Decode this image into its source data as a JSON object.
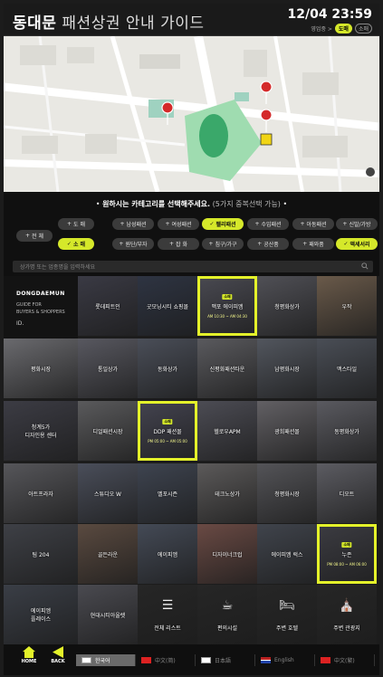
{
  "header": {
    "place": "동대문",
    "title_rest": "패션상권 안내 가이드",
    "clock": "12/04 23:59",
    "view_label": "영업중 >",
    "view_on": "도매",
    "view_off": "소매"
  },
  "category": {
    "prompt_main": "원하시는 카테고리를 선택해주세요.",
    "prompt_hint": "(5가지 중복선택 가능)",
    "chips": [
      {
        "label": "전 체",
        "selected": false
      },
      {
        "label": "도 매",
        "selected": false
      },
      {
        "label": "남성패션",
        "selected": false
      },
      {
        "label": "여성패션",
        "selected": false
      },
      {
        "label": "펠리패션",
        "selected": true
      },
      {
        "label": "수입패션",
        "selected": false
      },
      {
        "label": "아동패션",
        "selected": false
      },
      {
        "label": "신발/가방",
        "selected": false
      },
      {
        "label": "소 매",
        "selected": true
      },
      {
        "label": "원단/부자",
        "selected": false
      },
      {
        "label": "잡 화",
        "selected": false
      },
      {
        "label": "침구/가구",
        "selected": false
      },
      {
        "label": "공산품",
        "selected": false
      },
      {
        "label": "패와품",
        "selected": false
      },
      {
        "label": "액세서리",
        "selected": true
      }
    ],
    "search_placeholder": "상가명 또는 업종명을 입력하세요"
  },
  "sidebar": {
    "brand": "DONGDAEMUN",
    "guide": "GUIDE FOR\nBUYERS & SHOPPERS",
    "logo": "ID."
  },
  "tiles": [
    {
      "label": "롯데피트인",
      "bg": "#3a3a44"
    },
    {
      "label": "굿모닝시티 쇼핑몰",
      "bg": "#2e3442"
    },
    {
      "label": "맥포 에이피엠",
      "bg": "#4a4a52",
      "highlight": true,
      "tag": "소매",
      "hours": "AM 10:30 ~ AM 04:30"
    },
    {
      "label": "청평화상가",
      "bg": "#505056"
    },
    {
      "label": "우작",
      "bg": "#6a5a4a"
    },
    {
      "label": "평화시장",
      "bg": "#6a6a6e"
    },
    {
      "label": "통일상가",
      "bg": "#585860"
    },
    {
      "label": "동화상가",
      "bg": "#4a4e58"
    },
    {
      "label": "신평화패션타운",
      "bg": "#5a5a5e"
    },
    {
      "label": "남평화시장",
      "bg": "#52565e"
    },
    {
      "label": "맥스타일",
      "bg": "#4a4e56"
    },
    {
      "label": "청계5가\n디자인용 센터",
      "bg": "#3c3c44"
    },
    {
      "label": "디얼패션시장",
      "bg": "#5a5a5c"
    },
    {
      "label": "DDP 패션몰",
      "bg": "#444450",
      "highlight": true,
      "tag": "소매",
      "hours": "PM 05:00 ~ AM 05:00"
    },
    {
      "label": "헬로우APM",
      "bg": "#4c4c54"
    },
    {
      "label": "광희패션몰",
      "bg": "#626064"
    },
    {
      "label": "동평화상가",
      "bg": "#5a5a60"
    },
    {
      "label": "아트프라자",
      "bg": "#56565a"
    },
    {
      "label": "스튜디오 W",
      "bg": "#4a4e5a"
    },
    {
      "label": "벨포시즌",
      "bg": "#3e4450"
    },
    {
      "label": "테크노상가",
      "bg": "#5c5a5a"
    },
    {
      "label": "청평화시장",
      "bg": "#545458"
    },
    {
      "label": "디오트",
      "bg": "#5c5c62"
    },
    {
      "label": "팀 204",
      "bg": "#3e4046"
    },
    {
      "label": "골든라운",
      "bg": "#5a4a40"
    },
    {
      "label": "에이피엠",
      "bg": "#444a56"
    },
    {
      "label": "디자이너크럽",
      "bg": "#6a4a44"
    },
    {
      "label": "에이피엠 럭스",
      "bg": "#40444c"
    },
    {
      "label": "누존",
      "bg": "#3c3c42",
      "highlight": true,
      "tag": "소매",
      "hours": "PM 08:00 ~ AM 06:00"
    },
    {
      "label": "에이피엠\n플레이스",
      "bg": "#3a3e46"
    },
    {
      "label": "현대시티아울렛",
      "bg": "#4a4a50"
    },
    {
      "label": "전체 리스트",
      "bg": "#262626",
      "icon": "☰"
    },
    {
      "label": "편의시설",
      "bg": "#262626",
      "icon": "☕"
    },
    {
      "label": "주변 호텔",
      "bg": "#262626",
      "icon": "🛏"
    },
    {
      "label": "주변 관광지",
      "bg": "#262626",
      "icon": "⛪"
    }
  ],
  "footer": {
    "home": "HOME",
    "back": "BACK",
    "languages": [
      {
        "label": "한국어",
        "active": true
      },
      {
        "label": "中文(简)",
        "active": false
      },
      {
        "label": "日本語",
        "active": false
      },
      {
        "label": "English",
        "active": false
      },
      {
        "label": "中文(繁)",
        "active": false
      }
    ]
  }
}
